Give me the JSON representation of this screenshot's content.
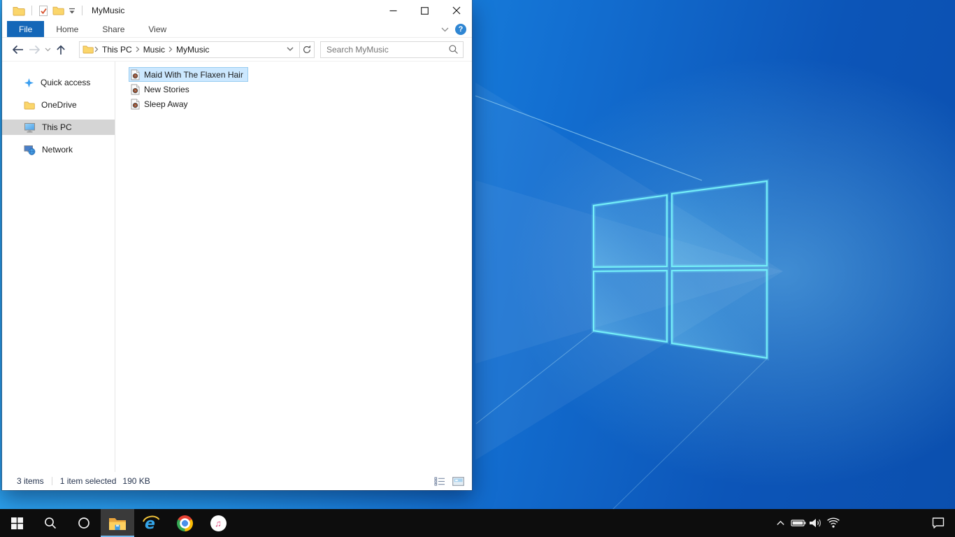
{
  "window": {
    "title": "MyMusic",
    "help_label": "?",
    "tabs": [
      {
        "label": "File",
        "active": true
      },
      {
        "label": "Home",
        "active": false
      },
      {
        "label": "Share",
        "active": false
      },
      {
        "label": "View",
        "active": false
      }
    ],
    "quick_access_toolbar_icons": [
      "explorer-folder-icon",
      "properties-check-icon",
      "new-folder-icon",
      "customize-qat-chevron-icon"
    ],
    "caption_buttons": [
      "minimize",
      "maximize",
      "close"
    ],
    "toolbar": {
      "nav_icons": [
        "back-arrow-icon",
        "forward-arrow-icon",
        "recent-locations-chevron-icon",
        "up-arrow-icon"
      ],
      "breadcrumb": {
        "crumbs": [
          "This PC",
          "Music",
          "MyMusic"
        ]
      },
      "address_icons": [
        "folder-icon",
        "address-dropdown-chevron-icon",
        "refresh-icon"
      ],
      "search": {
        "placeholder": "Search MyMusic",
        "icon": "search-magnifier-icon"
      }
    },
    "sidebar": {
      "items": [
        {
          "label": "Quick access",
          "icon": "quick-access-star-icon",
          "selected": false
        },
        {
          "label": "OneDrive",
          "icon": "onedrive-folder-icon",
          "selected": false
        },
        {
          "label": "This PC",
          "icon": "this-pc-monitor-icon",
          "selected": true
        },
        {
          "label": "Network",
          "icon": "network-icon",
          "selected": false
        }
      ]
    },
    "files": [
      {
        "name": "Maid With The Flaxen Hair",
        "icon": "audio-file-icon",
        "selected": true
      },
      {
        "name": "New Stories",
        "icon": "audio-file-icon",
        "selected": false
      },
      {
        "name": "Sleep Away",
        "icon": "audio-file-icon",
        "selected": false
      }
    ],
    "status": {
      "items_count": "3 items",
      "selection": "1 item selected",
      "selection_size": "190 KB",
      "view_icons": [
        "details-view-icon",
        "thumbnail-view-icon"
      ]
    }
  },
  "taskbar": {
    "left_icons": [
      "start-button",
      "search-icon",
      "cortana-icon",
      "file-explorer-icon",
      "internet-explorer-icon",
      "chrome-icon",
      "itunes-icon"
    ],
    "active_app": "file-explorer",
    "tray_icons": [
      "hidden-icons-chevron-icon",
      "battery-icon",
      "volume-icon",
      "wifi-icon",
      "action-center-icon"
    ]
  },
  "colors": {
    "accent_tab_blue": "#1467b8",
    "selection_fill": "#cce8ff",
    "selection_border": "#98ccf0",
    "sidebar_selected_gray": "#d5d5d5",
    "taskbar_black": "#0d0d0d",
    "taskbar_active_underline": "#76b9ed",
    "desktop_blue_light": "#2ba2ee",
    "desktop_blue_dark": "#0b4fae",
    "logo_stroke_cyan": "#74eef8",
    "folder_yellow": "#fbd66b"
  }
}
